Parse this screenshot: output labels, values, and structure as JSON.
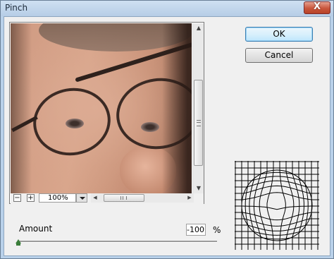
{
  "window": {
    "title": "Pinch",
    "close_symbol": "X"
  },
  "buttons": {
    "ok": "OK",
    "cancel": "Cancel"
  },
  "preview": {
    "zoom_value": "100%",
    "zoom_out": "−",
    "zoom_in": "+",
    "scroll_up": "▲",
    "scroll_down": "▼",
    "scroll_left": "◀",
    "scroll_right": "▶"
  },
  "amount": {
    "label": "Amount",
    "value": "-100",
    "unit": "%",
    "slider_fraction": 0.0
  },
  "colors": {
    "accent": "#3c7fb1",
    "slider_thumb": "#3a7d3a",
    "window_frame": "#b9d1ea"
  }
}
